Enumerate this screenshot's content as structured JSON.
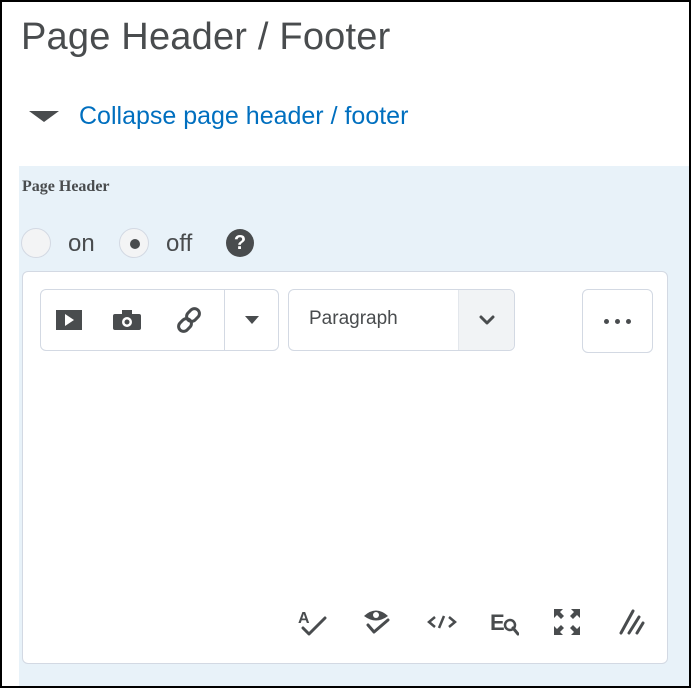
{
  "header": {
    "title": "Page Header / Footer"
  },
  "collapse": {
    "label": "Collapse page header / footer"
  },
  "section": {
    "label": "Page Header",
    "options": [
      {
        "label": "on",
        "selected": false
      },
      {
        "label": "off",
        "selected": true
      }
    ],
    "help_icon": "question-circle-icon"
  },
  "editor": {
    "toolbar": {
      "insert_icons": [
        "video-play-icon",
        "camera-icon",
        "link-icon",
        "dropdown-caret-icon"
      ],
      "format_select": {
        "value": "Paragraph"
      },
      "more_icon": "ellipsis-icon"
    },
    "bottom_icons": [
      "spellcheck-icon",
      "accessibility-checker-icon",
      "source-code-icon",
      "find-replace-icon",
      "fullscreen-icon",
      "resize-handle-icon"
    ]
  },
  "colors": {
    "link": "#006fbf",
    "text": "#494c4e",
    "panel_bg": "#e8f2f9",
    "border": "#d3d9e3"
  }
}
